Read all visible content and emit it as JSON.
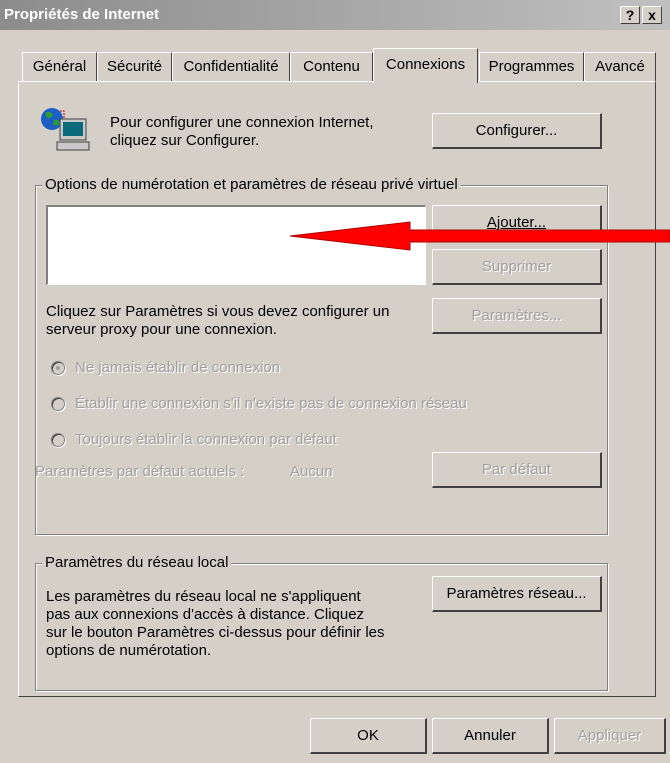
{
  "window": {
    "title": "Propriétés de Internet",
    "help_label": "?",
    "close_label": "x"
  },
  "tabs": [
    {
      "label": "Général"
    },
    {
      "label": "Sécurité"
    },
    {
      "label": "Confidentialité"
    },
    {
      "label": "Contenu"
    },
    {
      "label": "Connexions",
      "active": true
    },
    {
      "label": "Programmes"
    },
    {
      "label": "Avancé"
    }
  ],
  "setup": {
    "line1": "Pour configurer une connexion Internet,",
    "line2": "cliquez sur Configurer.",
    "button": "Configurer..."
  },
  "dialup": {
    "legend": "Options de numérotation et paramètres de réseau privé virtuel",
    "add_button": "Ajouter...",
    "remove_button": "Supprimer",
    "proxy_line1": "Cliquez sur Paramètres si vous devez configurer un",
    "proxy_line2": "serveur proxy pour une connexion.",
    "settings_button": "Paramètres...",
    "radio1": "Ne jamais établir de connexion",
    "radio2": "Établir une connexion s'il n'existe pas de connexion réseau",
    "radio3": "Toujours établir la connexion par défaut",
    "default_label": "Paramètres par défaut actuels :",
    "default_value": "Aucun",
    "default_button": "Par défaut"
  },
  "lan": {
    "legend": "Paramètres du réseau local",
    "line1": "Les paramètres du réseau local ne s'appliquent",
    "line2": "pas aux connexions d'accès à distance. Cliquez",
    "line3": "sur le bouton Paramètres ci-dessus pour définir les",
    "line4": "options de numérotation.",
    "button": "Paramètres réseau..."
  },
  "footer": {
    "ok": "OK",
    "cancel": "Annuler",
    "apply": "Appliquer"
  },
  "colors": {
    "arrow": "#ff0000",
    "face": "#d4d0c8"
  }
}
